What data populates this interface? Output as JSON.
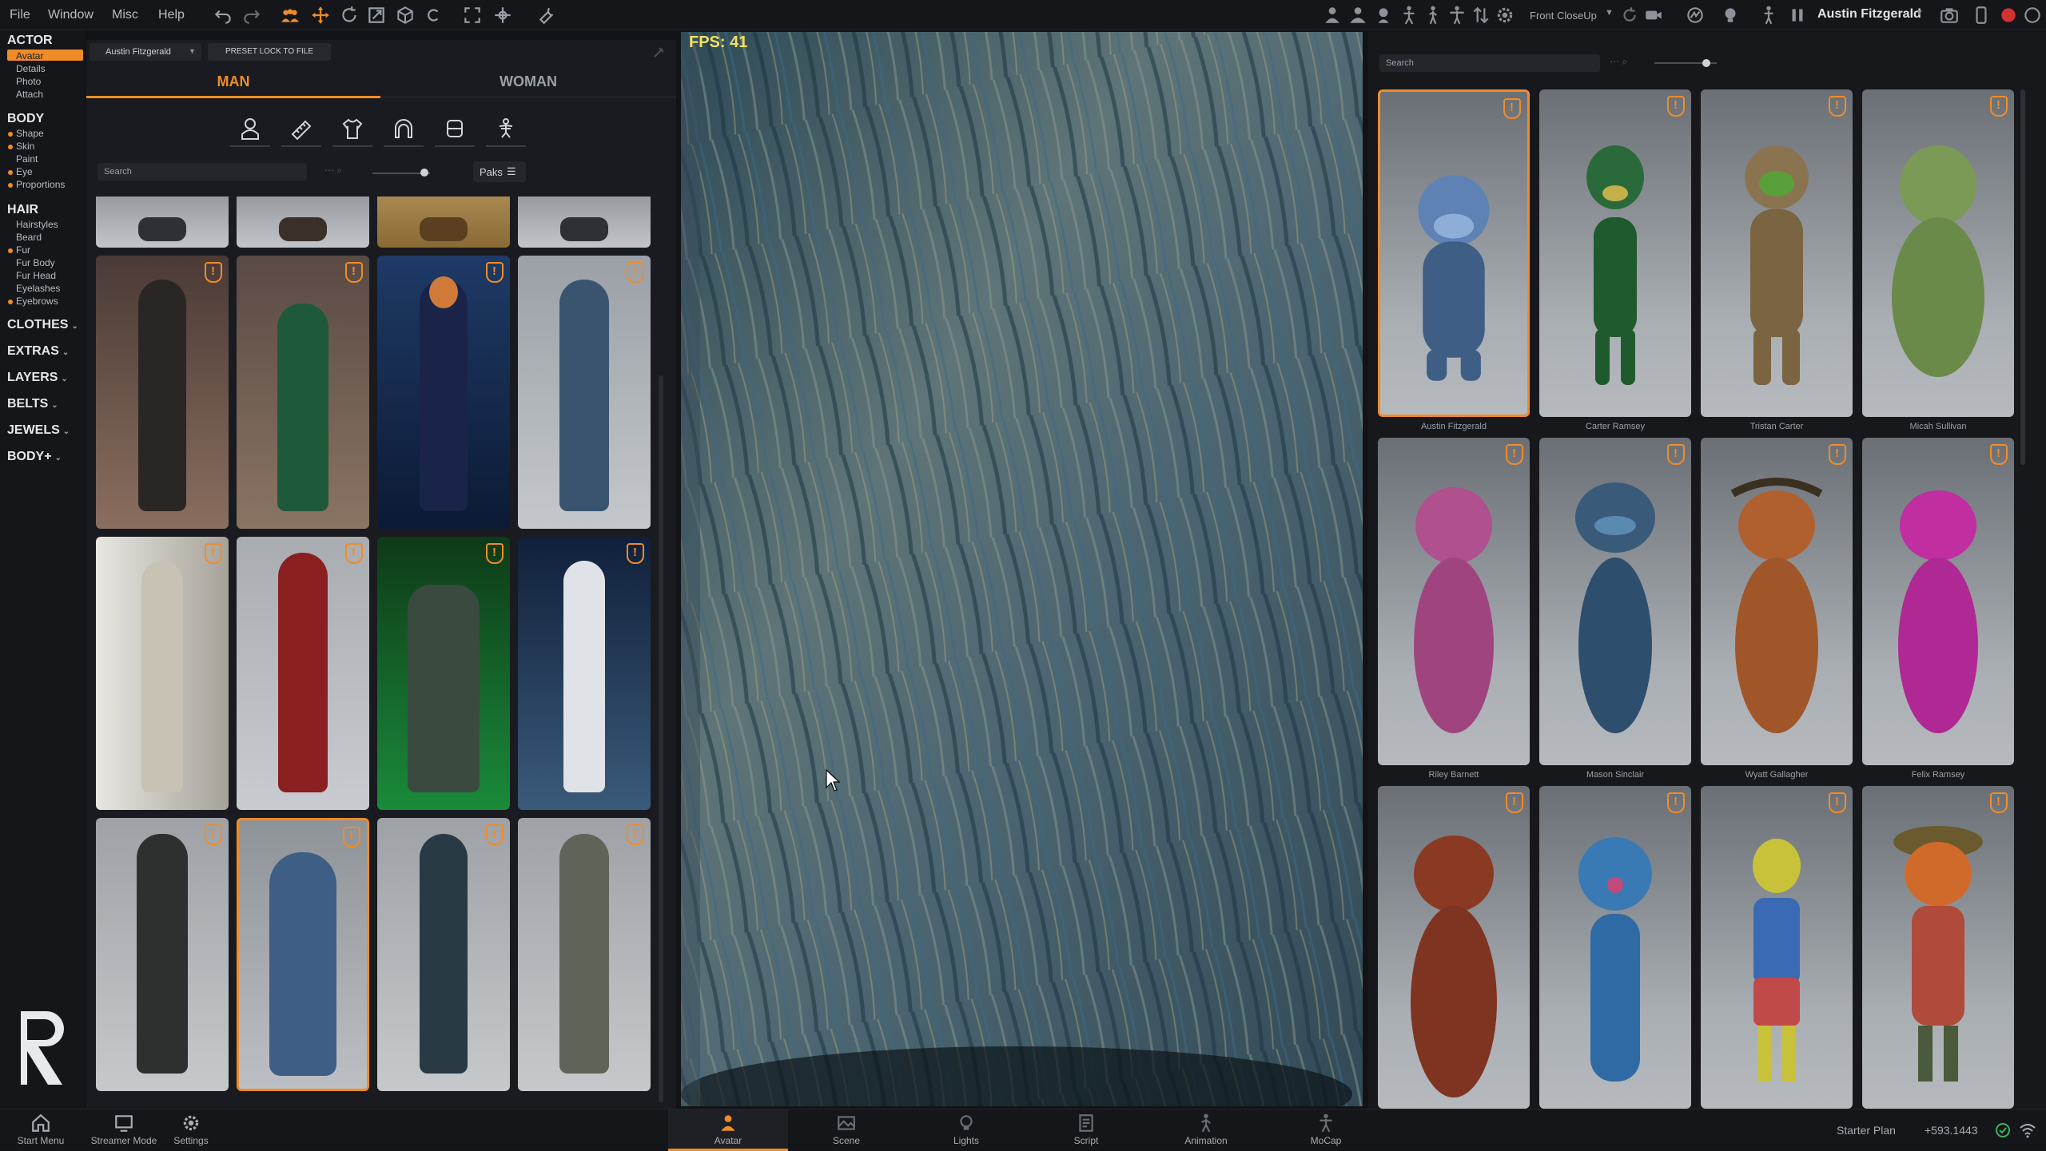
{
  "menu": [
    "File",
    "Window",
    "Misc",
    "Help"
  ],
  "topbar": {
    "camera_label": "Front CloseUp",
    "user_name": "Austin Fitzgerald"
  },
  "left_nav": {
    "sections": [
      {
        "title": "ACTOR",
        "items": [
          "Avatar",
          "Details",
          "Photo",
          "Attach"
        ],
        "active": "Avatar"
      },
      {
        "title": "BODY",
        "items": [
          "Shape",
          "Skin",
          "Paint",
          "Eye",
          "Proportions"
        ],
        "dotted": [
          "Shape",
          "Skin",
          "Eye",
          "Proportions"
        ]
      },
      {
        "title": "HAIR",
        "items": [
          "Hairstyles",
          "Beard",
          "Fur",
          "Fur Body",
          "Fur Head",
          "Eyelashes",
          "Eyebrows"
        ],
        "dotted": [
          "Fur",
          "Eyebrows"
        ]
      }
    ],
    "collapsed": [
      "CLOTHES",
      "EXTRAS",
      "LAYERS",
      "BELTS",
      "JEWELS",
      "BODY+"
    ]
  },
  "left_panel": {
    "actor_select": "Austin Fitzgerald",
    "preset_lock_button": "PRESET LOCK TO FILE",
    "tabs": [
      "MAN",
      "WOMAN"
    ],
    "active_tab": "MAN",
    "category_icons": [
      "person-icon",
      "ruler-icon",
      "shirt-icon",
      "hair-icon",
      "head-icon",
      "skeleton-icon"
    ],
    "search_placeholder": "Search",
    "paks_label": "Paks",
    "accent": "#f08c28"
  },
  "viewport": {
    "fps_label": "FPS: 41"
  },
  "right_panel": {
    "search_placeholder": "Search",
    "characters": [
      {
        "name": "Austin Fitzgerald",
        "selected": true
      },
      {
        "name": "Carter Ramsey"
      },
      {
        "name": "Tristan Carter"
      },
      {
        "name": "Micah Sullivan"
      },
      {
        "name": "Riley Barnett"
      },
      {
        "name": "Mason Sinclair"
      },
      {
        "name": "Wyatt Gallagher"
      },
      {
        "name": "Felix Ramsey"
      },
      {
        "name": ""
      },
      {
        "name": ""
      },
      {
        "name": ""
      },
      {
        "name": ""
      }
    ]
  },
  "bottom_bar": {
    "left": [
      "Start Menu",
      "Streamer Mode",
      "Settings"
    ],
    "center": [
      "Avatar",
      "Scene",
      "Lights",
      "Script",
      "Animation",
      "MoCap"
    ],
    "active_center": "Avatar",
    "plan_label": "Starter Plan",
    "credits": "+593.1443"
  }
}
